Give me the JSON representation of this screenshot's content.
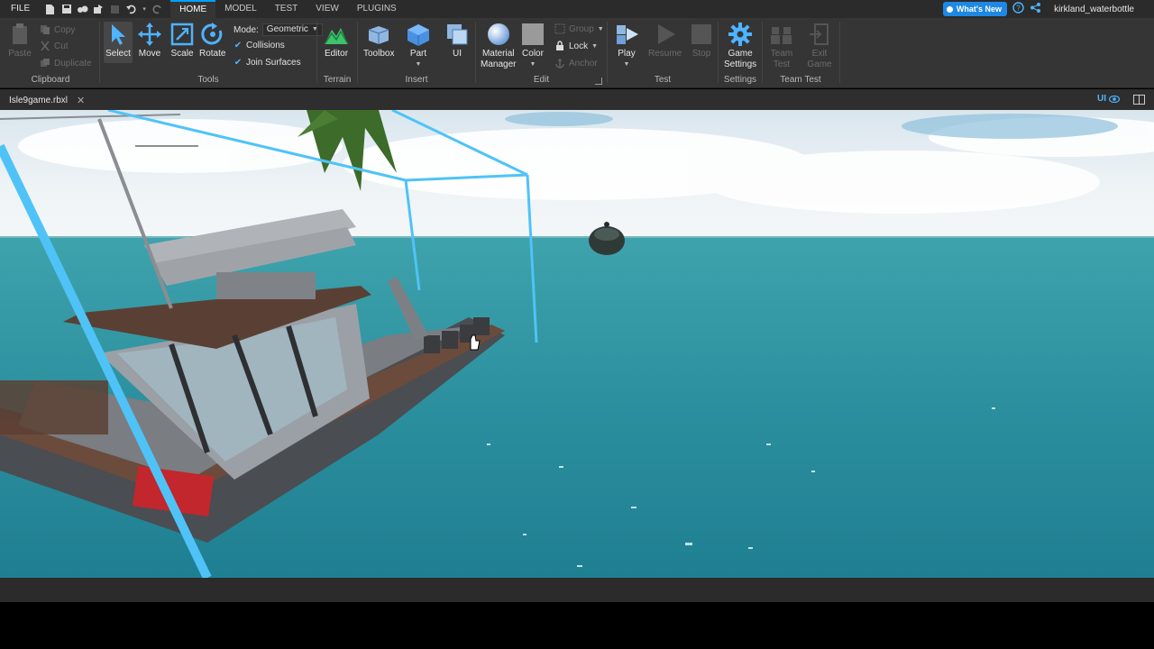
{
  "menubar": {
    "file": "FILE",
    "tabs": [
      "HOME",
      "MODEL",
      "TEST",
      "VIEW",
      "PLUGINS"
    ],
    "whats_new": "What's New",
    "username": "kirkland_waterbottle"
  },
  "ribbon": {
    "clipboard": {
      "label": "Clipboard",
      "paste": "Paste",
      "copy": "Copy",
      "cut": "Cut",
      "duplicate": "Duplicate"
    },
    "tools": {
      "label": "Tools",
      "select": "Select",
      "move": "Move",
      "scale": "Scale",
      "rotate": "Rotate",
      "mode_label": "Mode:",
      "mode_value": "Geometric",
      "collisions": "Collisions",
      "join_surfaces": "Join Surfaces"
    },
    "terrain": {
      "label": "Terrain",
      "editor": "Editor"
    },
    "insert": {
      "label": "Insert",
      "toolbox": "Toolbox",
      "part": "Part",
      "ui": "UI"
    },
    "edit": {
      "label": "Edit",
      "material_manager_1": "Material",
      "material_manager_2": "Manager",
      "color": "Color",
      "group": "Group",
      "lock": "Lock",
      "anchor": "Anchor"
    },
    "test": {
      "label": "Test",
      "play": "Play",
      "resume": "Resume",
      "stop": "Stop"
    },
    "settings": {
      "label": "Settings",
      "game_settings_1": "Game",
      "game_settings_2": "Settings"
    },
    "team_test": {
      "label": "Team Test",
      "team_test_1": "Team",
      "team_test_2": "Test",
      "exit_game_1": "Exit",
      "exit_game_2": "Game"
    }
  },
  "doc": {
    "tab_name": "Isle9game.rbxl",
    "ui_toggle": "UI"
  },
  "colors": {
    "accent": "#00a2ff",
    "whats_new_bg": "#1e88e5",
    "selection_box": "#4fc3f7",
    "ocean": "#2a8fa0",
    "sky": "#c9dbe6"
  }
}
